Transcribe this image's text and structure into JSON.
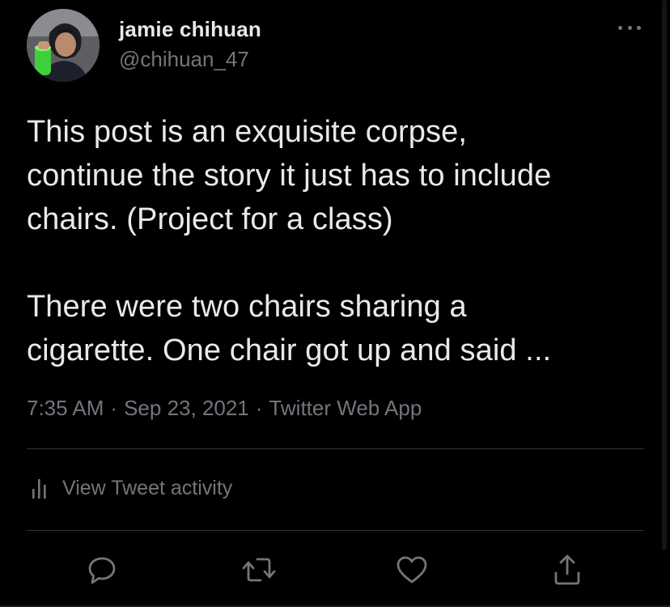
{
  "author": {
    "display_name": "jamie chihuan",
    "handle": "@chihuan_47",
    "avatar_icon": "profile-photo"
  },
  "more_icon": "more-horizontal-icon",
  "body": {
    "paragraph1": [
      "This post is an exquisite corpse,",
      "continue the story it just has to include",
      "chairs. (Project for a class)"
    ],
    "paragraph2": [
      "There were two chairs sharing a",
      "cigarette. One chair got up and said ..."
    ]
  },
  "meta": {
    "time": "7:35 AM",
    "date": "Sep 23, 2021",
    "source": "Twitter Web App",
    "separator": "·"
  },
  "activity": {
    "label": "View Tweet activity",
    "icon": "bar-chart-icon"
  },
  "actions": [
    {
      "name": "reply",
      "icon": "reply-icon"
    },
    {
      "name": "retweet",
      "icon": "retweet-icon"
    },
    {
      "name": "like",
      "icon": "heart-icon"
    },
    {
      "name": "share",
      "icon": "share-icon"
    }
  ],
  "colors": {
    "background": "#000000",
    "text_primary": "#e7e9ea",
    "text_secondary": "#71767b",
    "divider": "#2f3336"
  }
}
